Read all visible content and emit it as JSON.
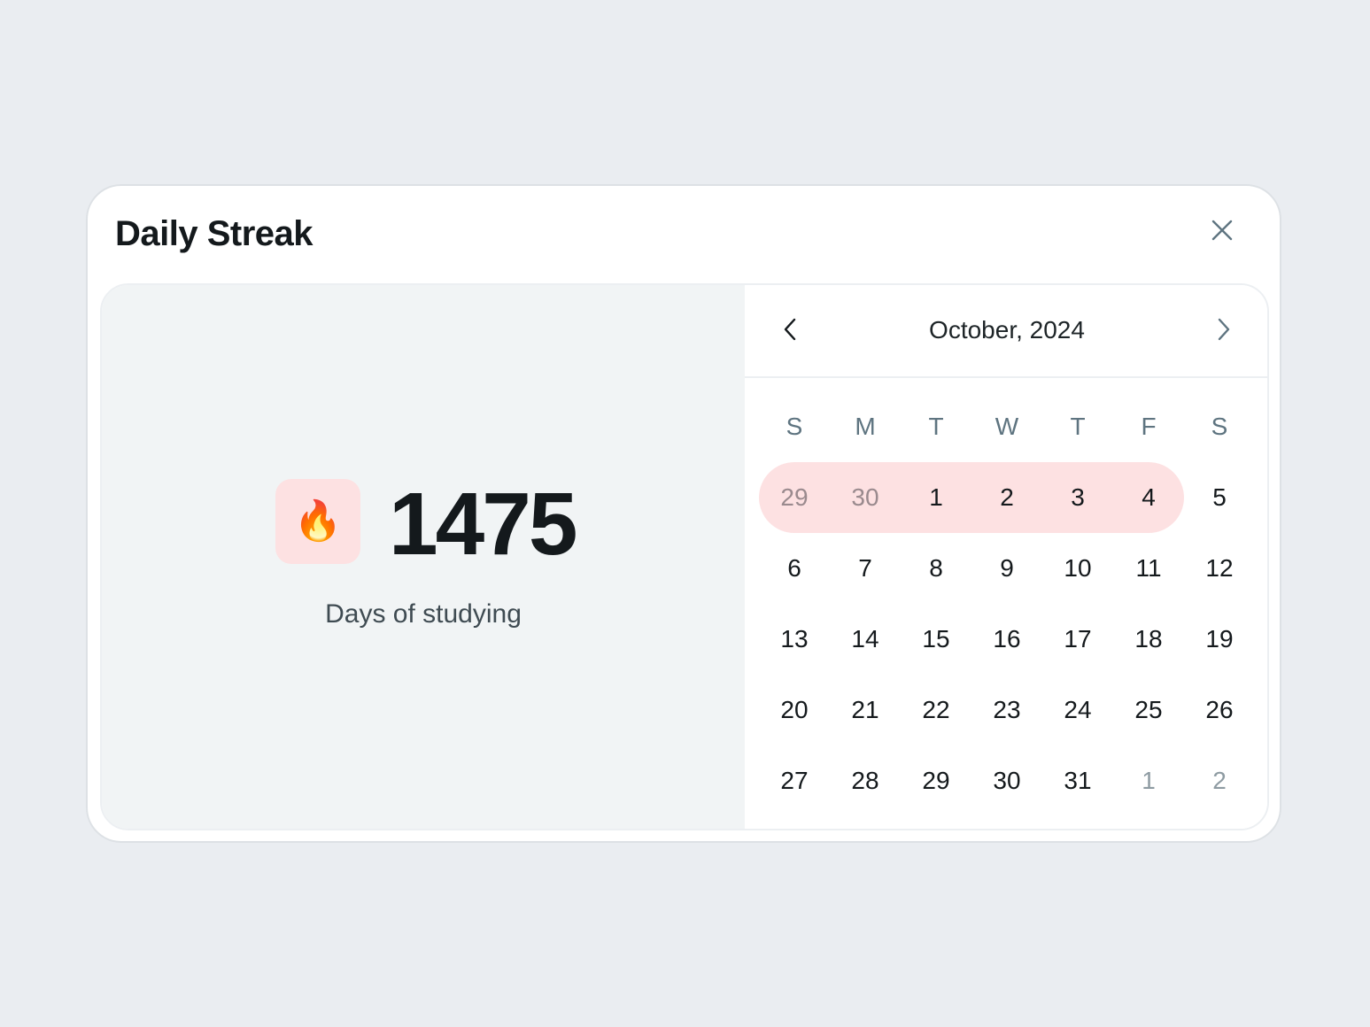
{
  "modal": {
    "title": "Daily Streak",
    "close_icon": "close-icon"
  },
  "streak": {
    "icon": "fire-icon",
    "icon_glyph": "🔥",
    "count": "1475",
    "caption": "Days of studying"
  },
  "calendar": {
    "month_label": "October, 2024",
    "prev_icon": "chevron-left-icon",
    "next_icon": "chevron-right-icon",
    "weekdays": [
      "S",
      "M",
      "T",
      "W",
      "T",
      "F",
      "S"
    ],
    "weeks": [
      [
        {
          "label": "29",
          "outside": true,
          "streak": true
        },
        {
          "label": "30",
          "outside": true,
          "streak": true
        },
        {
          "label": "1",
          "outside": false,
          "streak": true
        },
        {
          "label": "2",
          "outside": false,
          "streak": true
        },
        {
          "label": "3",
          "outside": false,
          "streak": true
        },
        {
          "label": "4",
          "outside": false,
          "streak": true
        },
        {
          "label": "5",
          "outside": false,
          "streak": false
        }
      ],
      [
        {
          "label": "6",
          "outside": false,
          "streak": false
        },
        {
          "label": "7",
          "outside": false,
          "streak": false
        },
        {
          "label": "8",
          "outside": false,
          "streak": false
        },
        {
          "label": "9",
          "outside": false,
          "streak": false
        },
        {
          "label": "10",
          "outside": false,
          "streak": false
        },
        {
          "label": "11",
          "outside": false,
          "streak": false
        },
        {
          "label": "12",
          "outside": false,
          "streak": false
        }
      ],
      [
        {
          "label": "13",
          "outside": false,
          "streak": false
        },
        {
          "label": "14",
          "outside": false,
          "streak": false
        },
        {
          "label": "15",
          "outside": false,
          "streak": false
        },
        {
          "label": "16",
          "outside": false,
          "streak": false
        },
        {
          "label": "17",
          "outside": false,
          "streak": false
        },
        {
          "label": "18",
          "outside": false,
          "streak": false
        },
        {
          "label": "19",
          "outside": false,
          "streak": false
        }
      ],
      [
        {
          "label": "20",
          "outside": false,
          "streak": false
        },
        {
          "label": "21",
          "outside": false,
          "streak": false
        },
        {
          "label": "22",
          "outside": false,
          "streak": false
        },
        {
          "label": "23",
          "outside": false,
          "streak": false
        },
        {
          "label": "24",
          "outside": false,
          "streak": false
        },
        {
          "label": "25",
          "outside": false,
          "streak": false
        },
        {
          "label": "26",
          "outside": false,
          "streak": false
        }
      ],
      [
        {
          "label": "27",
          "outside": false,
          "streak": false
        },
        {
          "label": "28",
          "outside": false,
          "streak": false
        },
        {
          "label": "29",
          "outside": false,
          "streak": false
        },
        {
          "label": "30",
          "outside": false,
          "streak": false
        },
        {
          "label": "31",
          "outside": false,
          "streak": false
        },
        {
          "label": "1",
          "outside": true,
          "streak": false
        },
        {
          "label": "2",
          "outside": true,
          "streak": false
        }
      ]
    ]
  },
  "colors": {
    "page_background": "#eaedf1",
    "panel_background": "#f1f4f5",
    "streak_highlight": "#fde1e2",
    "text_primary": "#14191c",
    "text_muted": "#5e7480"
  }
}
